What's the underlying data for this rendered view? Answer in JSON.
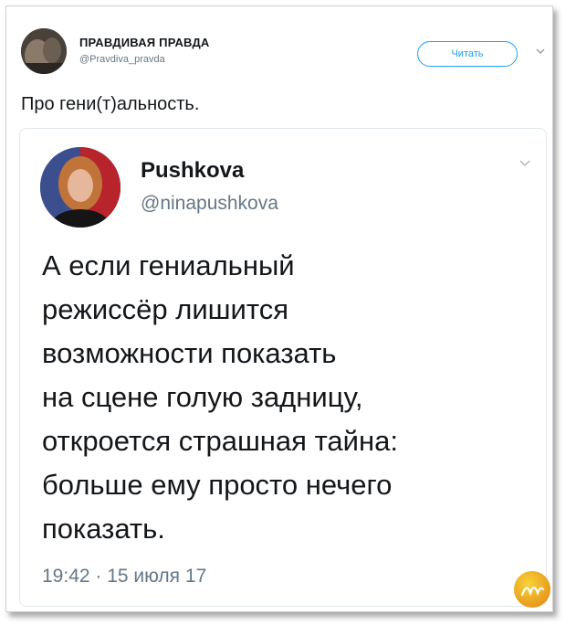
{
  "outer_tweet": {
    "author_name": "ПРАВДИВАЯ ПРАВДА",
    "author_handle": "@Pravdiva_pravda",
    "follow_label": "Читать",
    "text": "Про гени(т)альность."
  },
  "quoted_tweet": {
    "author_name": "Pushkova",
    "author_handle": "@ninapushkova",
    "text": "А если гениальный\nрежиссёр лишится\nвозможности показать\nна сцене голую задницу,\nоткроется страшная тайна:\nбольше ему просто нечего\nпоказать.",
    "timestamp": "19:42 · 15 июля 17"
  },
  "icons": {
    "outer_menu": "chevron-down-icon",
    "quote_menu": "chevron-down-icon",
    "watermark": "mika-logo"
  },
  "colors": {
    "accent": "#1da1f2",
    "text_primary": "#14171a",
    "text_secondary": "#657786",
    "border": "#e1e8ed"
  }
}
